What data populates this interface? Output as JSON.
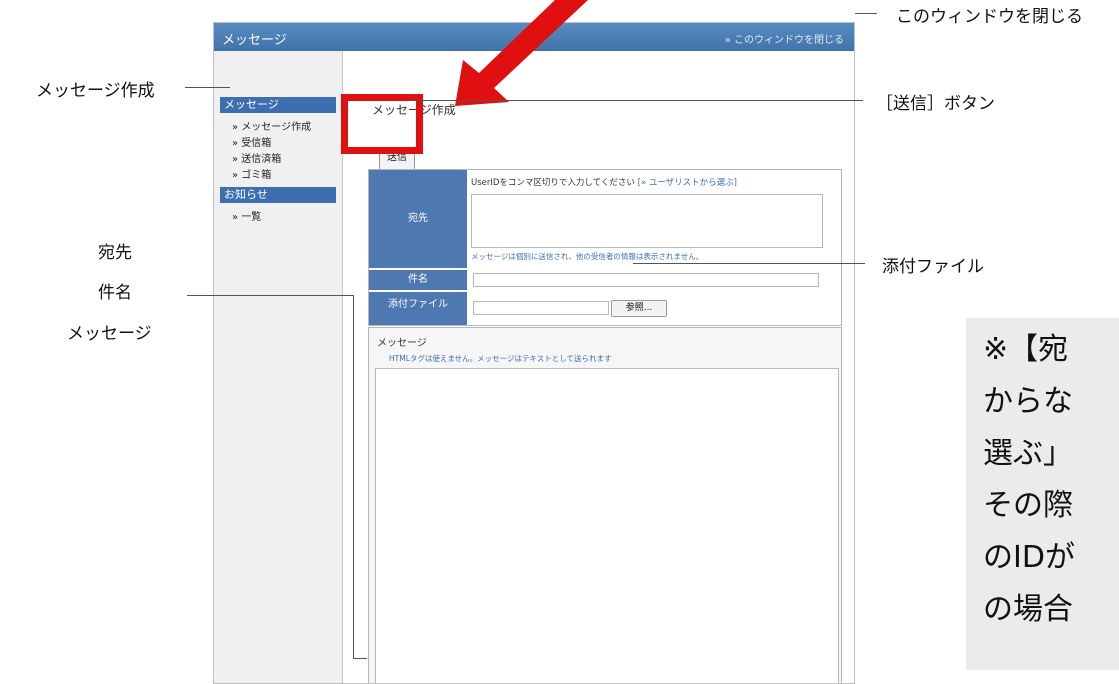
{
  "window": {
    "title": "メッセージ",
    "close_link": "» このウィンドウを閉じる"
  },
  "sidebar": {
    "sections": [
      {
        "label": "メッセージ",
        "items": [
          "» メッセージ作成",
          "» 受信箱",
          "» 送信済箱",
          "» ゴミ箱"
        ]
      },
      {
        "label": "お知らせ",
        "items": [
          "» 一覧"
        ]
      }
    ]
  },
  "compose": {
    "heading": "メッセージ作成",
    "send_button": "送信",
    "to_label": "宛先",
    "to_help": "UserIDをコンマ区切りで入力してください",
    "to_help_link": "[» ユーザリストから選ぶ]",
    "to_note": "メッセージは個別に送信され、他の受信者の情報は表示されません。",
    "subject_label": "件名",
    "attachment_label": "添付ファイル",
    "browse_button": "参照...",
    "message_label": "メッセージ",
    "message_note": "HTMLタグは使えません。メッセージはテキストとして送られます"
  },
  "annotations": {
    "close_window": "このウィンドウを閉じる",
    "compose": "メッセージ作成",
    "send_button": "［送信］ボタン",
    "attachment": "添付ファイル",
    "fields": [
      "宛先",
      "件名",
      "メッセージ"
    ]
  },
  "note_panel": {
    "lines": [
      "※【宛",
      "からな",
      "選ぶ」",
      "その際",
      "のIDが",
      "の場合"
    ]
  },
  "colors": {
    "accent": "#3d6fb0",
    "highlight": "#e01010",
    "label_bg": "#4d78b1"
  }
}
